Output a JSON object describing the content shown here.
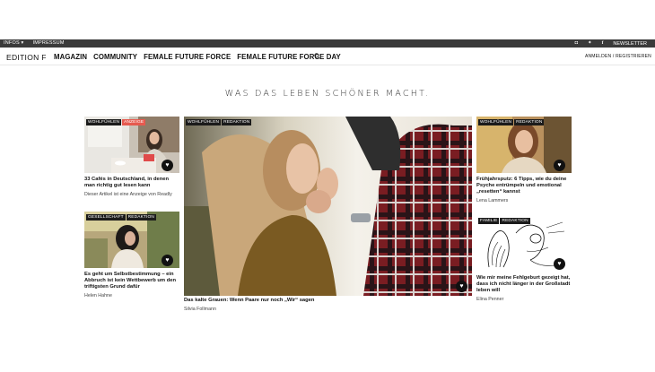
{
  "topbar": {
    "info": "INFOS",
    "impressum": "IMPRESSUM",
    "newsletter": "NEWSLETTER"
  },
  "nav": {
    "logo": "EDITION F",
    "items": [
      "MAGAZIN",
      "COMMUNITY",
      "FEMALE FUTURE FORCE",
      "FEMALE FUTURE FORCE DAY"
    ],
    "account": "ANMELDEN / REGISTRIEREN"
  },
  "headline": "WAS DAS LEBEN SCHÖNER MACHT.",
  "cards": [
    {
      "tags": [
        "WOHLFÜHLEN",
        "ANZEIGE"
      ],
      "title": "33 Cafés in Deutschland, in denen man richtig gut lesen kann",
      "byline": "Dieser Artikel ist eine Anzeige von Readly"
    },
    {
      "tags": [
        "GESELLSCHAFT",
        "REDAKTION"
      ],
      "title": "Es geht um Selbstbestimmung – ein Abbruch ist kein Wettbewerb um den triftigsten Grund dafür",
      "byline": "Helen Hahne"
    },
    {
      "tags": [
        "WOHLFÜHLEN",
        "REDAKTION"
      ],
      "title": "Das kalte Grauen: Wenn Paare nur noch „Wir“ sagen",
      "byline": "Silvia Follmann"
    },
    {
      "tags": [
        "WOHLFÜHLEN",
        "REDAKTION"
      ],
      "title": "Frühjahrsputz: 6 Tipps, wie du deine Psyche entrümpeln und emotional „resetten“ kannst",
      "byline": "Lena Lammers"
    },
    {
      "tags": [
        "FAMILIE",
        "REDAKTION"
      ],
      "title": "Wie mir meine Fehlgeburt gezeigt hat, dass ich nicht länger in der Großstadt leben will",
      "byline": "Elina Penner"
    }
  ]
}
